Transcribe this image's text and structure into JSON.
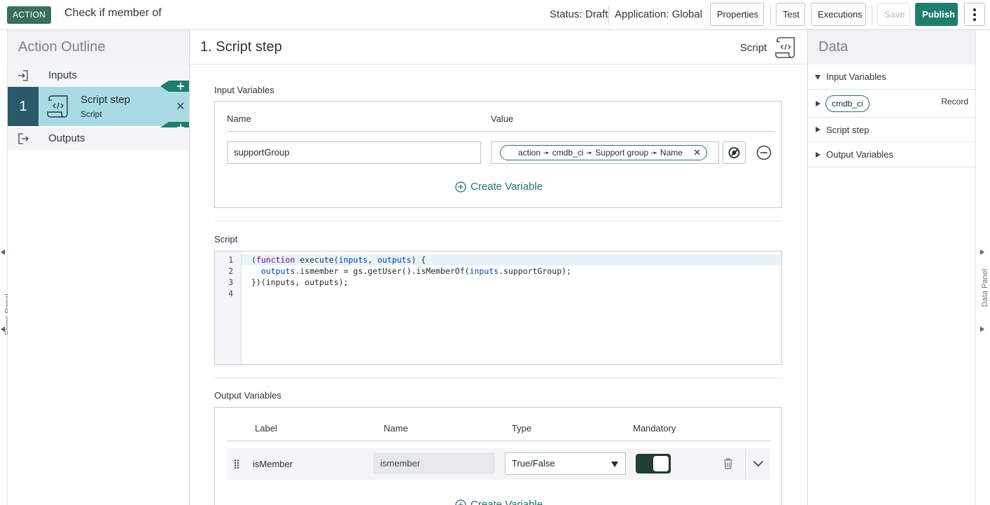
{
  "header": {
    "badge": "ACTION",
    "title": "Check if member of",
    "status": "Status: Draft",
    "application": "Application: Global",
    "buttons": {
      "properties": "Properties",
      "test": "Test",
      "executions": "Executions",
      "save": "Save",
      "publish": "Publish"
    }
  },
  "left_rail": {
    "label": "Steps Panel"
  },
  "outline": {
    "title": "Action Outline",
    "inputs_label": "Inputs",
    "outputs_label": "Outputs",
    "step": {
      "number": "1",
      "name": "Script step",
      "type": "Script",
      "close": "✕"
    }
  },
  "main": {
    "title": "1.  Script step",
    "step_type": "Script",
    "input_variables": {
      "label": "Input Variables",
      "col_name": "Name",
      "col_value": "Value",
      "row": {
        "name": "supportGroup",
        "value": "action ➛ cmdb_ci ➛ Support group ➛ Name",
        "clear": "✕"
      },
      "create_label": "Create Variable"
    },
    "script": {
      "label": "Script",
      "line_numbers": [
        "1",
        "2",
        "3",
        "4"
      ]
    },
    "output_variables": {
      "label": "Output Variables",
      "col_label": "Label",
      "col_name": "Name",
      "col_type": "Type",
      "col_mandatory": "Mandatory",
      "row": {
        "label": "isMember",
        "name": "ismember",
        "type": "True/False",
        "mandatory": true
      },
      "create_label": "Create Variable"
    }
  },
  "data_panel": {
    "title": "Data",
    "input_variables": "Input Variables",
    "ci_name": "cmdb_ci",
    "ci_type": "Record",
    "script_step": "Script step",
    "output_variables": "Output Variables"
  },
  "right_rail": {
    "label": "Data Panel"
  },
  "colors": {
    "accent": "#1f7d6d",
    "badge": "#3a6e5e",
    "step_highlight": "#a9dbe4",
    "step_number": "#2a5a6a"
  }
}
